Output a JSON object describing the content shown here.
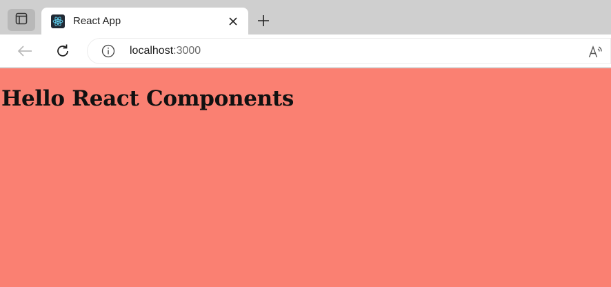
{
  "browser": {
    "tab": {
      "title": "React App",
      "favicon": "react-logo-icon"
    },
    "address": {
      "host": "localhost",
      "port": ":3000"
    },
    "icons": {
      "tab_actions": "tab-actions-icon",
      "close": "close-icon",
      "new_tab": "plus-icon",
      "back": "back-arrow-icon",
      "reload": "reload-icon",
      "site_info": "info-icon",
      "read_aloud": "read-aloud-icon"
    }
  },
  "page": {
    "background": "#fa8072",
    "heading": "Hello React Components"
  }
}
